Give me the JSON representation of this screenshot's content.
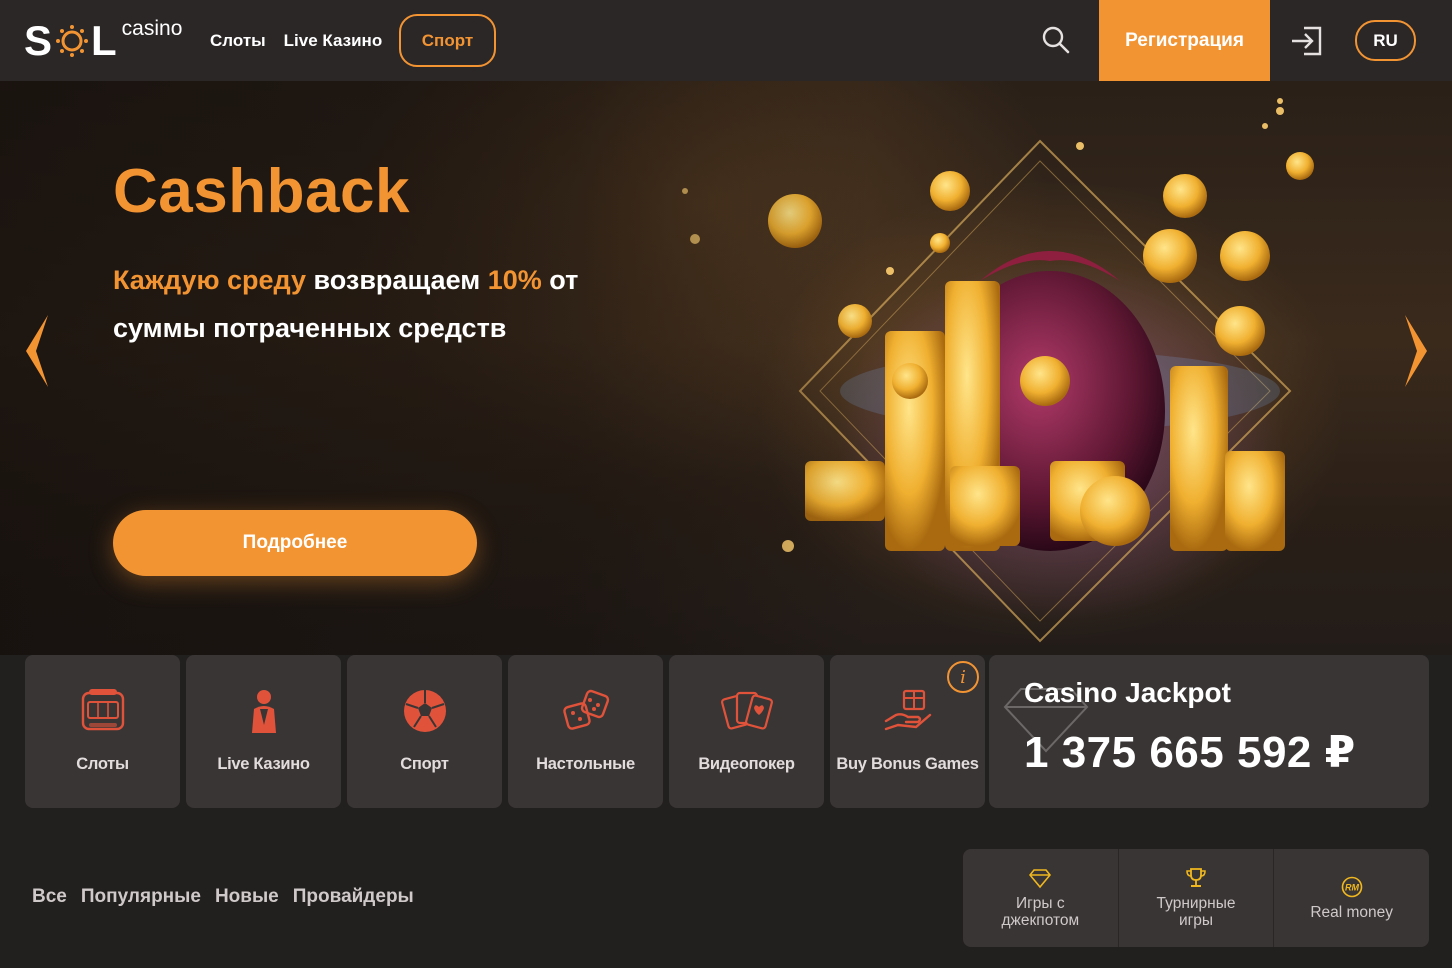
{
  "header": {
    "logo_text": "SOL",
    "logo_sub": "casino",
    "nav": [
      {
        "label": "Слоты"
      },
      {
        "label": "Live Казино"
      }
    ],
    "sport_label": "Спорт",
    "register_label": "Регистрация",
    "lang_label": "RU"
  },
  "hero": {
    "title": "Cashback",
    "sub_hl1": "Каждую среду",
    "sub_text1": " возвращаем ",
    "sub_hl2": "10%",
    "sub_text2": " от суммы потраченных средств",
    "cta_label": "Подробнее"
  },
  "categories": [
    {
      "label": "Слоты",
      "icon": "slot-machine-icon"
    },
    {
      "label": "Live Казино",
      "icon": "dealer-icon"
    },
    {
      "label": "Спорт",
      "icon": "soccer-ball-icon"
    },
    {
      "label": "Настольные",
      "icon": "dice-icon"
    },
    {
      "label": "Видеопокер",
      "icon": "cards-icon"
    },
    {
      "label": "Buy Bonus Games",
      "icon": "gift-hand-icon"
    }
  ],
  "info_badge": "i",
  "jackpot": {
    "title": "Casino Jackpot",
    "value": "1 375 665 592 ₽"
  },
  "filters": [
    {
      "label": "Все"
    },
    {
      "label": "Популярные"
    },
    {
      "label": "Новые"
    },
    {
      "label": "Провайдеры"
    }
  ],
  "modes": [
    {
      "label": "Игры с\nджекпотом",
      "icon": "diamond-icon"
    },
    {
      "label": "Турнирные\nигры",
      "icon": "trophy-icon"
    },
    {
      "label": "Real money",
      "icon": "rm-icon"
    }
  ],
  "colors": {
    "accent": "#f39433",
    "header_bg": "#2b2727",
    "page_bg": "#221f1f",
    "tile_bg": "#3a3535"
  }
}
